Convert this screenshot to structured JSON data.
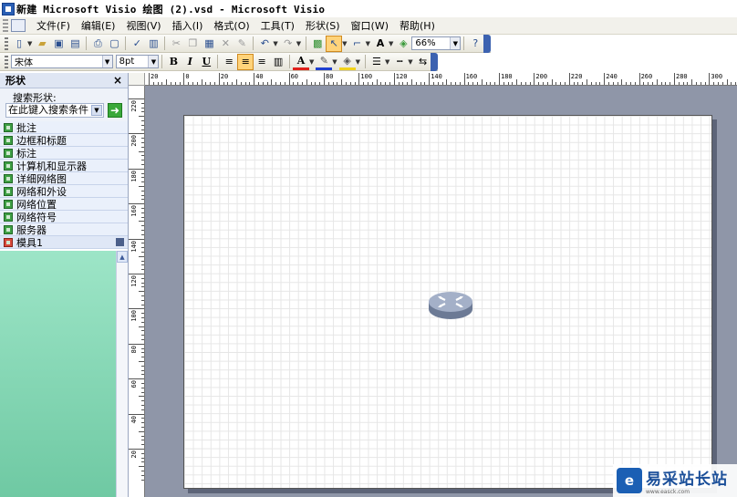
{
  "window": {
    "title": "新建 Microsoft Visio 绘图 (2).vsd - Microsoft Visio"
  },
  "menu": [
    "文件(F)",
    "编辑(E)",
    "视图(V)",
    "插入(I)",
    "格式(O)",
    "工具(T)",
    "形状(S)",
    "窗口(W)",
    "帮助(H)"
  ],
  "toolbar": {
    "zoom_value": "66%"
  },
  "format_toolbar": {
    "font_name": "宋体",
    "font_size": "8pt",
    "bold": "B",
    "italic": "I",
    "underline": "U",
    "font_color_glyph": "A"
  },
  "shapes_pane": {
    "title": "形状",
    "close": "×",
    "search_label": "搜索形状:",
    "search_value": "在此键入搜索条件",
    "stencils": [
      "批注",
      "边框和标题",
      "标注",
      "计算机和显示器",
      "详细网络图",
      "网络和外设",
      "网络位置",
      "网络符号",
      "服务器"
    ],
    "active_stencil": "模具1"
  },
  "rulers": {
    "horizontal_labels": [
      "20",
      "0",
      "20",
      "40",
      "60",
      "80",
      "100",
      "120",
      "140",
      "160",
      "180",
      "200",
      "220",
      "240",
      "260",
      "280",
      "300"
    ],
    "vertical_labels": [
      "220",
      "200",
      "180",
      "160",
      "140",
      "120",
      "100",
      "80",
      "60",
      "40",
      "20"
    ]
  },
  "watermark": {
    "name": "易采站长站",
    "url": "www.easck.com"
  },
  "colors": {
    "canvas_bg": "#8f96a8",
    "stencil_body": "#86d7b5",
    "toolbar_accent": "#3c62b0"
  }
}
